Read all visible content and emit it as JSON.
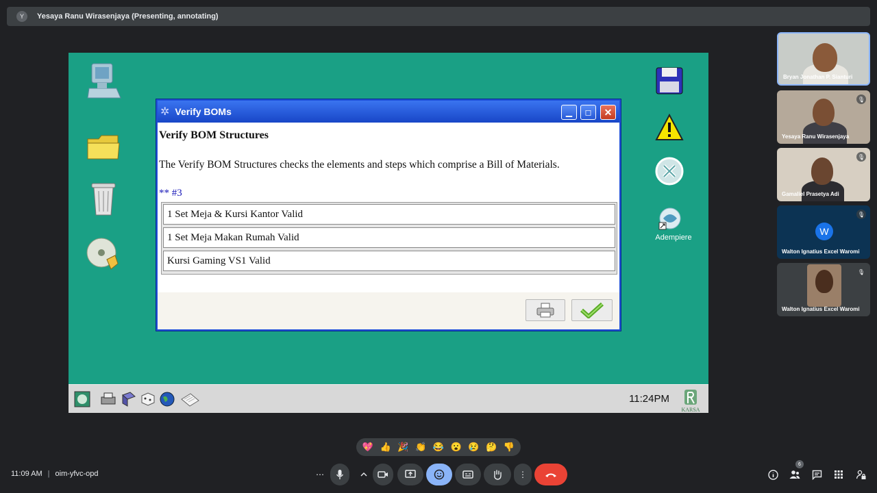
{
  "presenter": {
    "initial": "Y",
    "label": "Yesaya Ranu Wirasenjaya (Presenting, annotating)"
  },
  "desktop": {
    "adempiere_label": "Adempiere",
    "clock": "11:24PM",
    "logo_text": "KARSA"
  },
  "dialog": {
    "title": "Verify BOMs",
    "heading": "Verify BOM Structures",
    "description": "The Verify BOM Structures checks the elements and steps which comprise a Bill of Materials.",
    "ref": "** #3",
    "items": [
      "1 Set Meja & Kursi Kantor Valid",
      "1 Set Meja Makan Rumah Valid",
      "Kursi Gaming VS1 Valid"
    ]
  },
  "participants": [
    {
      "name": "Bryan Jonathan P. Sianturi",
      "type": "video",
      "active": true
    },
    {
      "name": "Yesaya Ranu Wirasenjaya",
      "type": "video",
      "muted": true
    },
    {
      "name": "Gamaliel Prasetya Adi",
      "type": "video",
      "muted": true
    },
    {
      "name": "Walton Ignatius Excel Waromi",
      "type": "avatar",
      "initial": "W",
      "muted": true
    },
    {
      "name": "Walton Ignatius Excel Waromi",
      "type": "video",
      "muted": true
    }
  ],
  "meeting": {
    "time": "11:09 AM",
    "separator": "|",
    "code": "oim-yfvc-opd",
    "participant_count": "6"
  },
  "reactions": [
    "💖",
    "👍",
    "🎉",
    "👏",
    "😂",
    "😮",
    "😢",
    "🤔",
    "👎"
  ],
  "colors": {
    "desktop_bg": "#1aa085",
    "dialog_title": "#1846c7",
    "end_call": "#ea4335",
    "highlight": "#8ab4f8"
  }
}
